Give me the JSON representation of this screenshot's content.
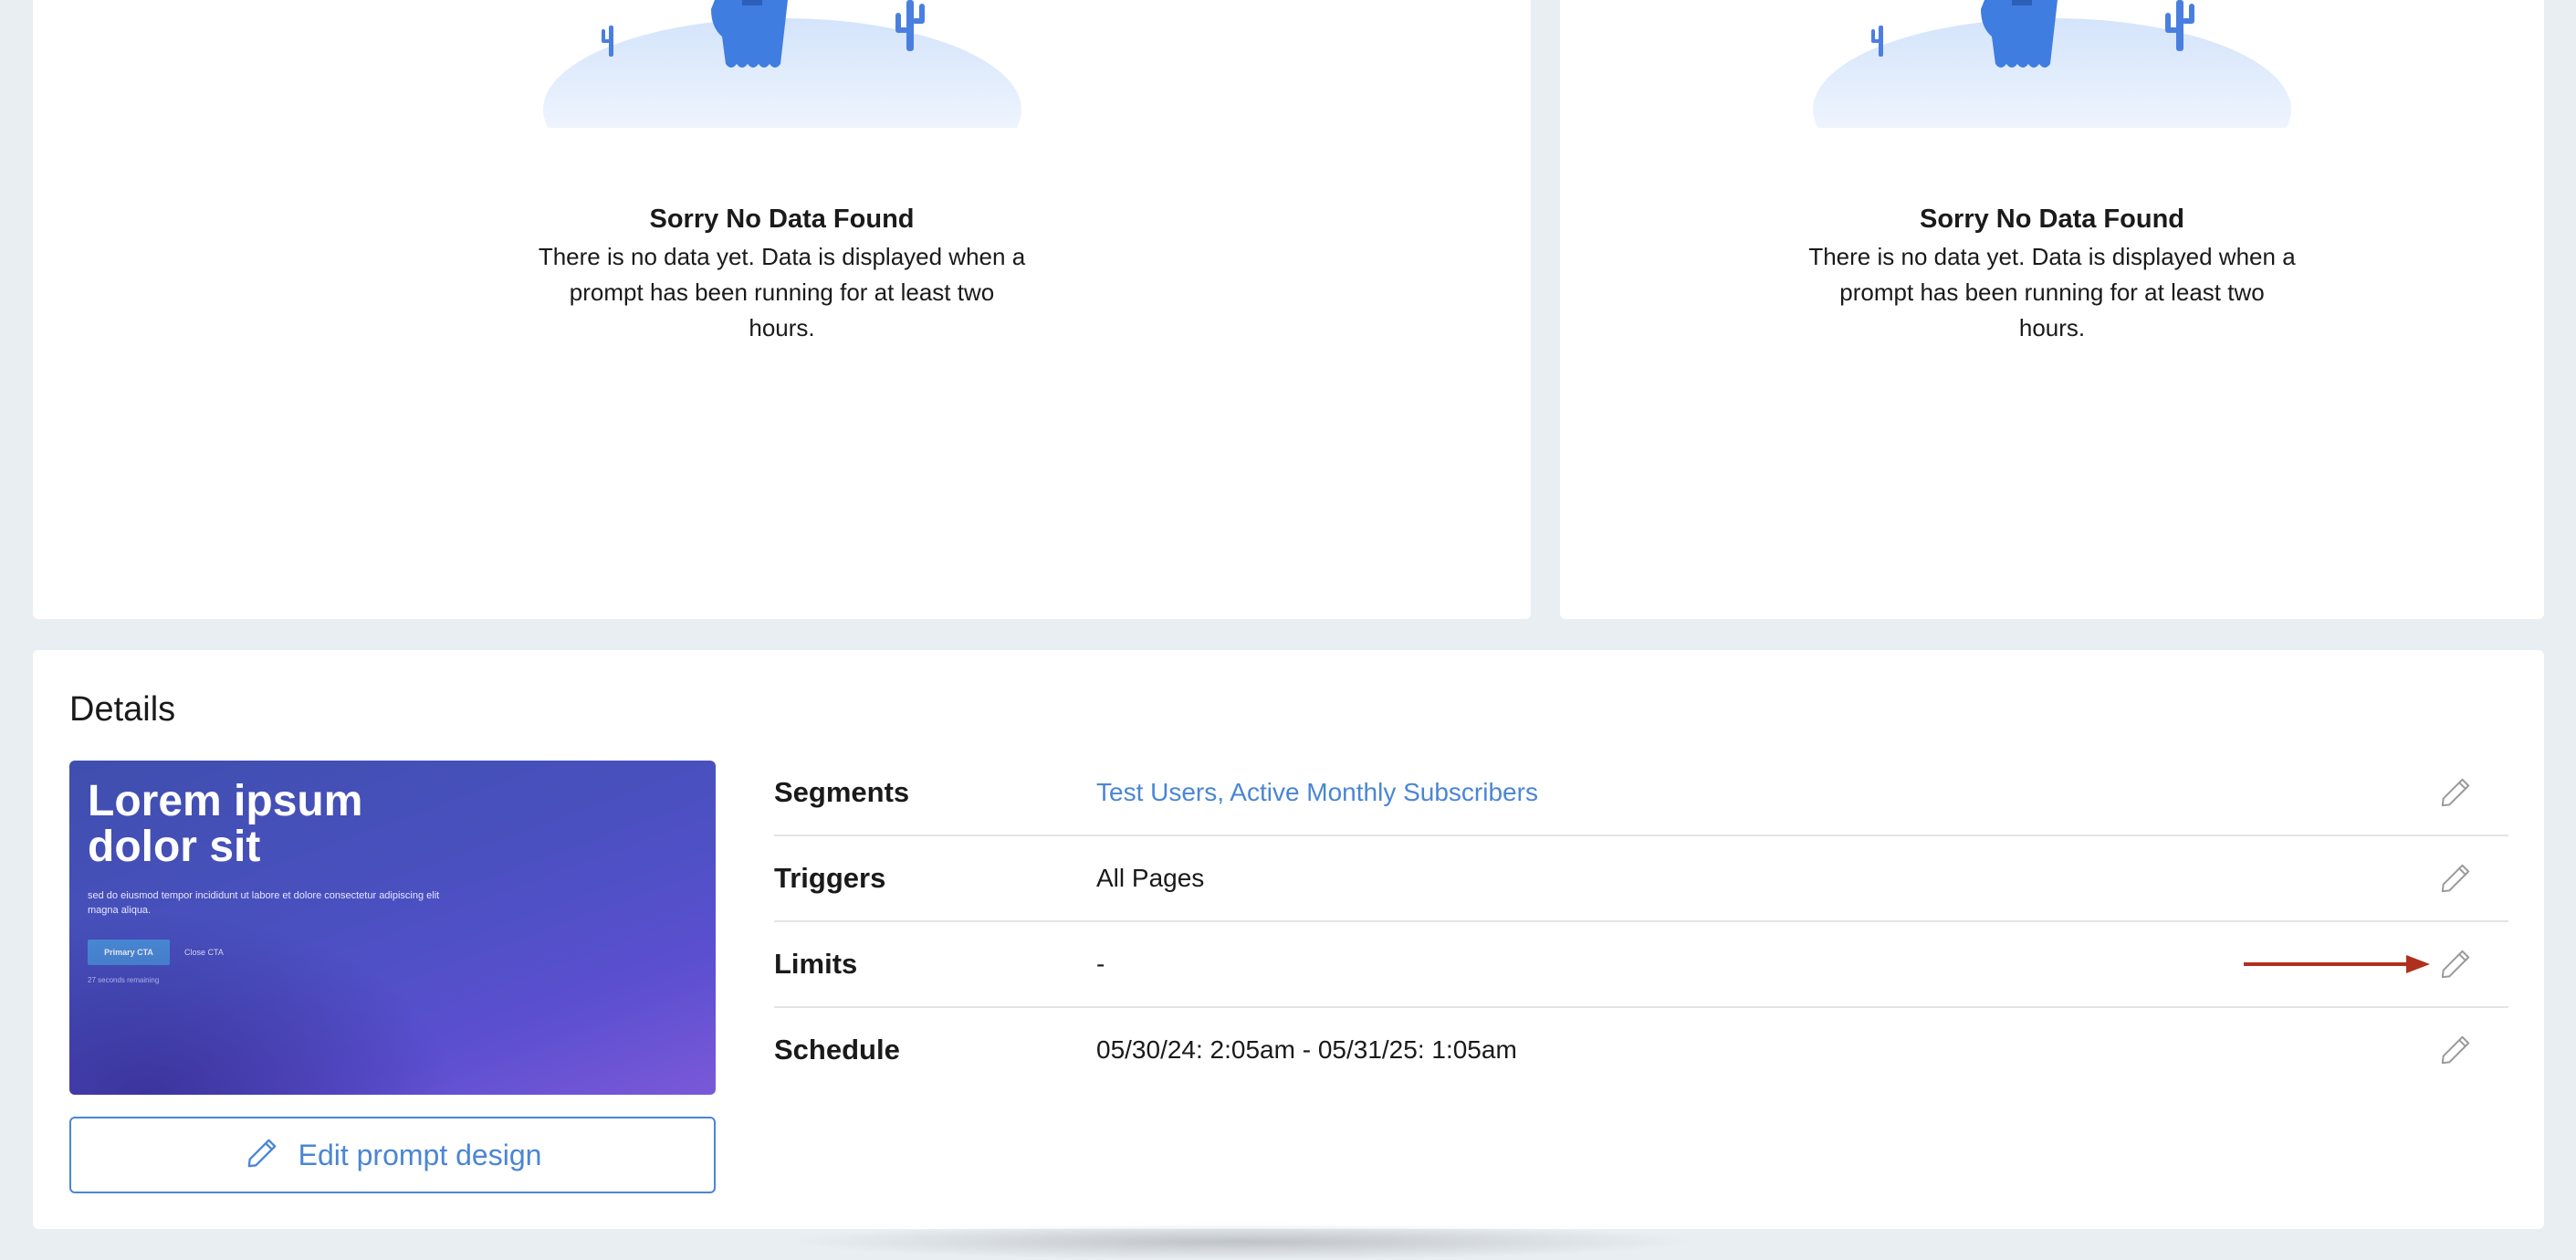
{
  "empty_states": [
    {
      "title": "Sorry No Data Found",
      "description": "There is no data yet. Data is displayed when a prompt has been running for at least two hours."
    },
    {
      "title": "Sorry No Data Found",
      "description": "There is no data yet. Data is displayed when a prompt has been running for at least two hours."
    }
  ],
  "details": {
    "title": "Details",
    "preview": {
      "heading": "Lorem ipsum dolor sit",
      "body": "sed do eiusmod tempor incididunt ut labore et dolore consectetur adipiscing elit magna aliqua.",
      "primary_cta": "Primary CTA",
      "close_cta": "Close CTA",
      "remaining": "27 seconds remaining"
    },
    "edit_design_label": "Edit prompt design",
    "rows": [
      {
        "label": "Segments",
        "value": "Test Users, Active Monthly Subscribers"
      },
      {
        "label": "Triggers",
        "value": "All Pages"
      },
      {
        "label": "Limits",
        "value": "-"
      },
      {
        "label": "Schedule",
        "value": "05/30/24: 2:05am - 05/31/25: 1:05am"
      }
    ]
  },
  "colors": {
    "background": "#e9eef3",
    "card": "#ffffff",
    "accent": "#4a86d4",
    "arrow": "#b0301e",
    "ghost": "#3f7de0"
  },
  "icons": {
    "edit": "pencil-icon",
    "illustration": "ghost-desert-illustration",
    "arrow": "arrow-right-icon"
  }
}
